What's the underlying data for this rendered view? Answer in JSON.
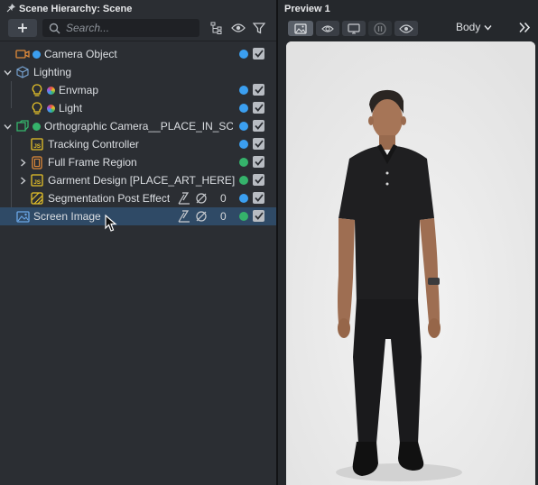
{
  "hierarchy": {
    "title": "Scene Hierarchy: Scene",
    "search_placeholder": "Search...",
    "items": [
      {
        "label": "Camera Object",
        "icon": "camera-icon",
        "status_color": "#3b9ff0"
      },
      {
        "label": "Lighting",
        "icon": "cube-icon",
        "status_color": null
      },
      {
        "label": "Envmap",
        "icon": "bulb-icon",
        "status_color": "#3b9ff0"
      },
      {
        "label": "Light",
        "icon": "bulb-icon",
        "status_color": "#3b9ff0"
      },
      {
        "label": "Orthographic Camera__PLACE_IN_SCE",
        "icon": "ortho-camera-icon",
        "status_color": "#3b9ff0"
      },
      {
        "label": "Tracking Controller",
        "icon": "js-script-icon",
        "status_color": "#3b9ff0"
      },
      {
        "label": "Full Frame Region",
        "icon": "region-icon",
        "status_color": "#35b36b"
      },
      {
        "label": "Garment Design [PLACE_ART_HERE]",
        "icon": "js-script-icon",
        "status_color": "#35b36b"
      },
      {
        "label": "Segmentation Post Effect",
        "icon": "post-effect-icon",
        "status_color": "#3b9ff0",
        "count": "0"
      },
      {
        "label": "Screen Image",
        "icon": "image-icon",
        "status_color": "#35b36b",
        "count": "0"
      }
    ]
  },
  "preview": {
    "title": "Preview 1",
    "dropdown": "Body"
  },
  "colors": {
    "accent_blue": "#3b9ff0",
    "status_green": "#35b36b",
    "selection": "#2f4a66",
    "js_yellow": "#e6c229",
    "camera_orange": "#e08a3a"
  }
}
